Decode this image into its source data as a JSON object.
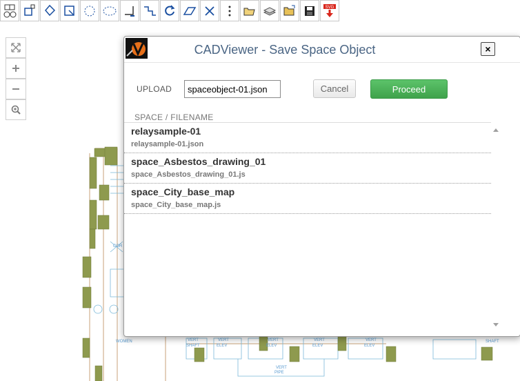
{
  "toolbar": {
    "buttons": [
      {
        "icon": "layer-nav-icon"
      },
      {
        "icon": "rotate-copy-icon"
      },
      {
        "icon": "zoom-window-icon"
      },
      {
        "icon": "zoom-extents-icon"
      },
      {
        "icon": "circle-select-icon"
      },
      {
        "icon": "cloud-select-icon"
      },
      {
        "icon": "measure-corner-icon"
      },
      {
        "icon": "measure-step-icon"
      },
      {
        "icon": "rotate-icon"
      },
      {
        "icon": "eraser-icon"
      },
      {
        "icon": "close-x-icon"
      },
      {
        "icon": "more-vertical-icon"
      },
      {
        "icon": "open-folder-icon"
      },
      {
        "icon": "layers-stack-icon"
      },
      {
        "icon": "open-file-icon"
      },
      {
        "icon": "save-disk-icon"
      },
      {
        "icon": "svg-download-icon"
      }
    ],
    "svg_badge": "SVG"
  },
  "zoom_controls": [
    {
      "icon": "zoom-extents-arrows-icon"
    },
    {
      "icon": "zoom-in-plus-icon"
    },
    {
      "icon": "zoom-out-minus-icon"
    },
    {
      "icon": "zoom-magnifier-icon"
    }
  ],
  "drawing_labels": {
    "vert_shaft_1": "VERT",
    "vert_shaft_1b": "SHAFT",
    "vert_elev_1": "VERT",
    "vert_elev_1b": "ELEV",
    "vert_elev_2": "VERT",
    "vert_elev_2b": "ELEV",
    "vert_elev_3": "VERT",
    "vert_elev_3b": "ELEV",
    "vert_elev_4": "VERT",
    "vert_elev_4b": "ELEV",
    "vert_pipe": "VERT",
    "vert_pipe_b": "PIPE",
    "shaft_right": "SHAFT",
    "women": "WOMEN",
    "corr": "COR"
  },
  "modal": {
    "title": "CADViewer - Save Space Object",
    "close_label": "×",
    "upload_label": "UPLOAD",
    "filename_value": "spaceobject-01.json",
    "cancel_label": "Cancel",
    "proceed_label": "Proceed",
    "list_header": "SPACE / FILENAME",
    "items": [
      {
        "name": "relaysample-01",
        "file": "relaysample-01.json"
      },
      {
        "name": "space_Asbestos_drawing_01",
        "file": "space_Asbestos_drawing_01.js"
      },
      {
        "name": "space_City_base_map",
        "file": "space_City_base_map.js"
      }
    ]
  },
  "colors": {
    "title": "#4a6584",
    "proceed": "#4cae4c",
    "wall_fill": "#8e9a4e",
    "drawing_line": "#5a9bd0"
  }
}
